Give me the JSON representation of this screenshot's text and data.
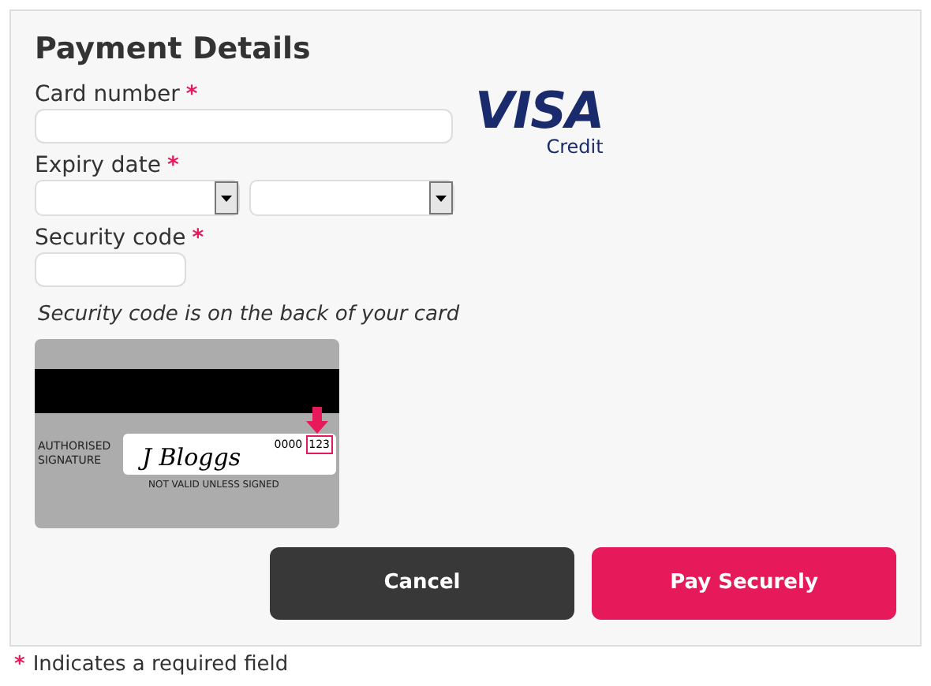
{
  "title": "Payment Details",
  "card_number": {
    "label": "Card number",
    "required": true
  },
  "card_brand": {
    "name": "VISA",
    "type": "Credit"
  },
  "expiry_date": {
    "label": "Expiry date",
    "required": true
  },
  "security_code": {
    "label": "Security code",
    "required": true
  },
  "hint": "Security code is on the back of your card",
  "card_back": {
    "signature_label": "AUTHORISED SIGNATURE",
    "signature": "J Bloggs",
    "number": "0000",
    "code": "123",
    "note": "NOT VALID UNLESS SIGNED"
  },
  "buttons": [
    {
      "label": "Cancel",
      "kind": "secondary"
    },
    {
      "label": "Pay Securely",
      "kind": "primary"
    }
  ],
  "footer": {
    "mark": "*",
    "text": "Indicates a required field"
  }
}
